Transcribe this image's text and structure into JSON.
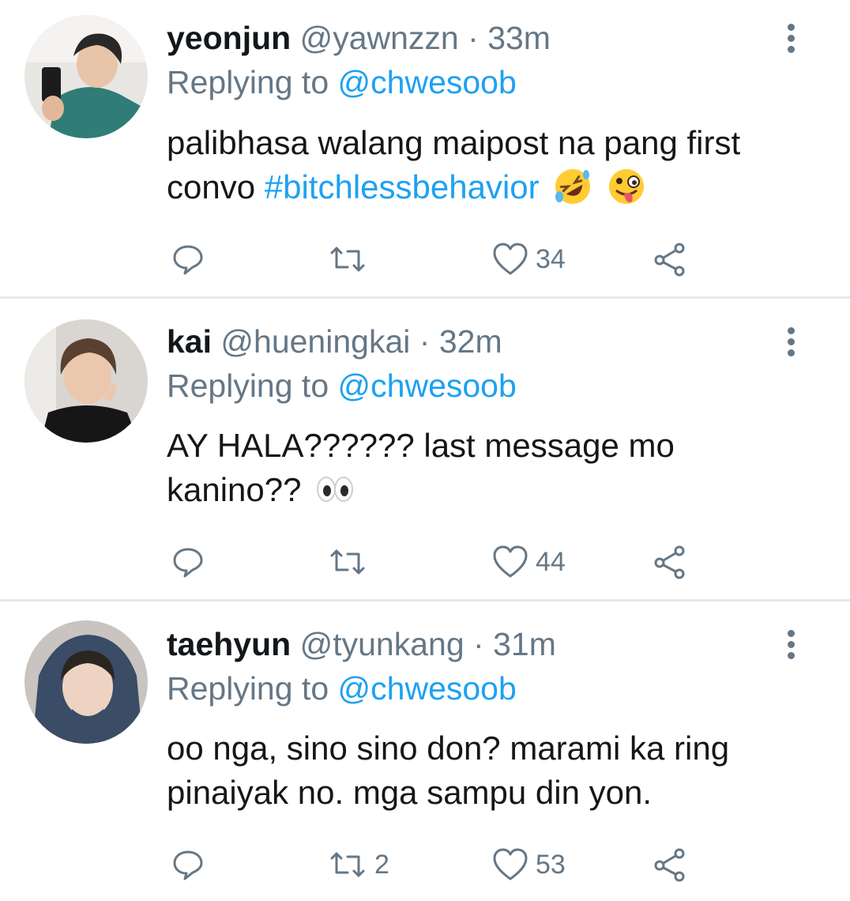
{
  "colors": {
    "accent": "#1da1f2",
    "muted": "#657786",
    "text": "#14171a",
    "divider": "#e6e9eb"
  },
  "tweets": [
    {
      "name": "yeonjun",
      "handle": "@yawnzzn",
      "time": "33m",
      "replying_prefix": "Replying to",
      "replying_to": "@chwesoob",
      "body_text": "palibhasa walang maipost na pang first convo",
      "hashtag": "#bitchlessbehavior",
      "emojis": [
        "rolling-on-floor-laughing-emoji",
        "zany-face-emoji"
      ],
      "reply_count": "",
      "retweet_count": "",
      "like_count": "34"
    },
    {
      "name": "kai",
      "handle": "@hueningkai",
      "time": "32m",
      "replying_prefix": "Replying to",
      "replying_to": "@chwesoob",
      "body_text": "AY HALA?????? last message mo kanino??",
      "emojis": [
        "eyes-emoji"
      ],
      "reply_count": "",
      "retweet_count": "",
      "like_count": "44"
    },
    {
      "name": "taehyun",
      "handle": "@tyunkang",
      "time": "31m",
      "replying_prefix": "Replying to",
      "replying_to": "@chwesoob",
      "body_text": "oo nga, sino sino don? marami ka ring pinaiyak no. mga sampu din yon.",
      "emojis": [],
      "reply_count": "",
      "retweet_count": "2",
      "like_count": "53"
    }
  ],
  "separator": "·",
  "icons": [
    "reply-icon",
    "retweet-icon",
    "like-icon",
    "share-icon",
    "more-icon"
  ]
}
